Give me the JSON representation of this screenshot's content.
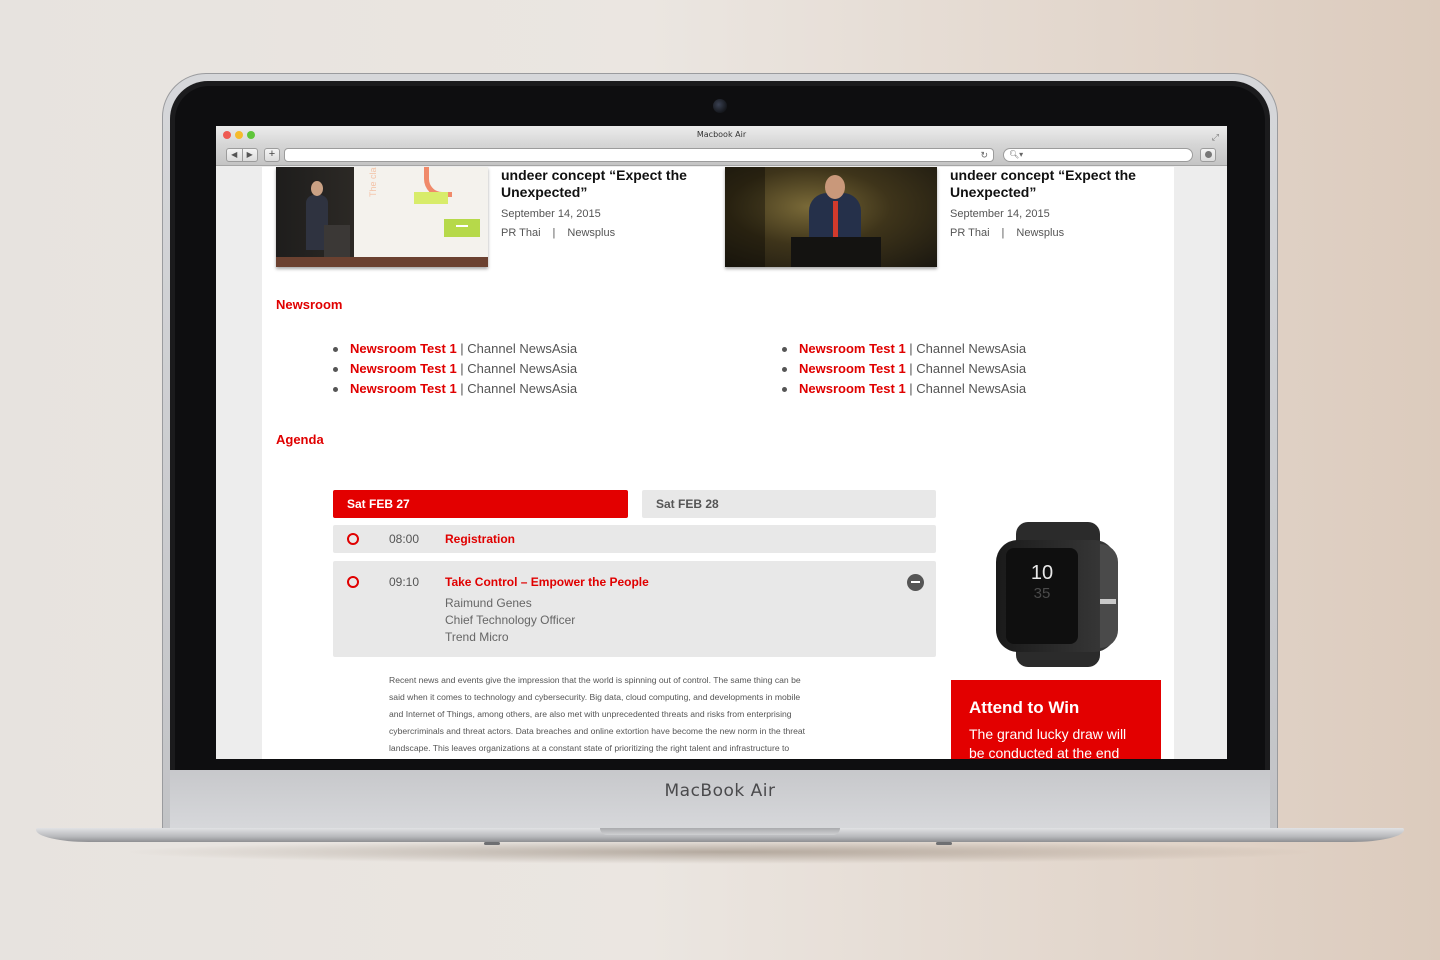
{
  "device": {
    "brand": "MacBook Air"
  },
  "browser": {
    "window_title": "Macbook Air",
    "traffic_lights": [
      "#ee5a52",
      "#f5bb2d",
      "#5fc53a"
    ],
    "back_icon": "back-arrow-icon",
    "forward_icon": "forward-arrow-icon",
    "new_tab_label": "+",
    "reload_glyph": "↻",
    "search_glyph": "🔍︎▾"
  },
  "news_items": [
    {
      "title": "undeer concept “Expect the Unexpected”",
      "date": "September 14, 2015",
      "source": "PR Thai",
      "separator": "|",
      "outlet": "Newsplus"
    },
    {
      "title": "undeer concept “Expect the Unexpected”",
      "date": "September 14, 2015",
      "source": "PR Thai",
      "separator": "|",
      "outlet": "Newsplus"
    }
  ],
  "newsroom": {
    "heading": "Newsroom",
    "left": [
      {
        "title": "Newsroom Test 1",
        "channel": " | Channel NewsAsia"
      },
      {
        "title": "Newsroom Test 1",
        "channel": " | Channel NewsAsia"
      },
      {
        "title": "Newsroom Test 1",
        "channel": " | Channel NewsAsia"
      }
    ],
    "right": [
      {
        "title": "Newsroom Test 1",
        "channel": " | Channel NewsAsia"
      },
      {
        "title": "Newsroom Test 1",
        "channel": " | Channel NewsAsia"
      },
      {
        "title": "Newsroom Test 1",
        "channel": " | Channel NewsAsia"
      }
    ]
  },
  "agenda": {
    "heading": "Agenda",
    "tabs": [
      {
        "label": "Sat FEB 27",
        "active": true
      },
      {
        "label": "Sat FEB 28",
        "active": false
      }
    ],
    "sessions": [
      {
        "time": "08:00",
        "title": "Registration"
      },
      {
        "time": "09:10",
        "title": "Take Control – Empower the People",
        "speaker": "Raimund Genes",
        "role": "Chief Technology Officer",
        "company": "Trend Micro"
      }
    ],
    "description_lines": [
      "Recent news and events give the impression that the world is spinning out of control. The same thing can be",
      "said when it comes to technology and cybersecurity. Big data, cloud computing, and developments in mobile",
      "and Internet of Things, among others, are also met with unprecedented threats and risks from enterprising",
      "cybercriminals and threat actors. Data breaches and online extortion have become the new norm in the threat",
      "landscape. This leaves organizations at a constant state of prioritizing the right talent and infrastructure to"
    ]
  },
  "promo": {
    "watch_time": "10",
    "watch_minutes": "35",
    "title": "Attend to Win",
    "text_line1": "The grand lucky draw will",
    "text_line2": "be conducted at the end"
  },
  "colors": {
    "accent": "#e30000",
    "tab_inactive": "#e8e8e8"
  }
}
